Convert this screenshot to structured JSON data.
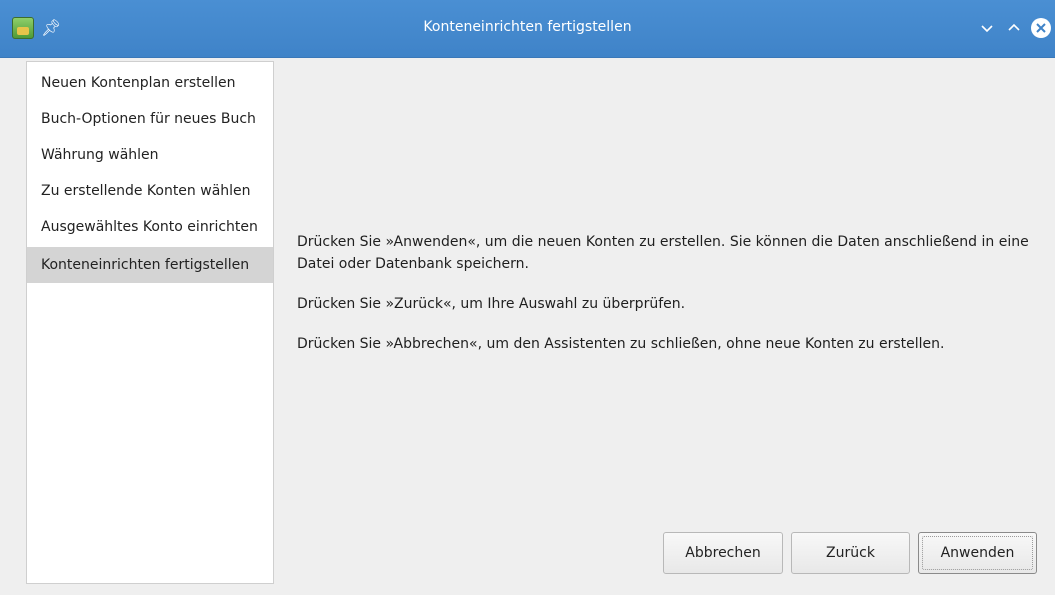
{
  "window": {
    "title": "Konteneinrichten fertigstellen",
    "icons": [
      "app-icon",
      "pin-icon",
      "minimize-icon",
      "maximize-icon",
      "close-icon"
    ],
    "accent_color": "#3f83c8"
  },
  "sidebar": {
    "items": [
      {
        "label": "Neuen Kontenplan erstellen",
        "active": false
      },
      {
        "label": "Buch-Optionen für neues Buch",
        "active": false
      },
      {
        "label": "Währung wählen",
        "active": false
      },
      {
        "label": "Zu erstellende Konten wählen",
        "active": false
      },
      {
        "label": "Ausgewähltes Konto einrichten",
        "active": false
      },
      {
        "label": "Konteneinrichten fertigstellen",
        "active": true
      }
    ]
  },
  "content": {
    "paragraphs": [
      "Drücken Sie »Anwenden«, um die neuen Konten zu erstellen. Sie können die Daten anschließend in eine Datei oder Datenbank speichern.",
      "Drücken Sie »Zurück«, um Ihre Auswahl zu überprüfen.",
      "Drücken Sie »Abbrechen«, um den Assistenten zu schließen, ohne neue Konten zu erstellen."
    ]
  },
  "buttons": {
    "cancel": "Abbrechen",
    "back": "Zurück",
    "apply": "Anwenden"
  }
}
